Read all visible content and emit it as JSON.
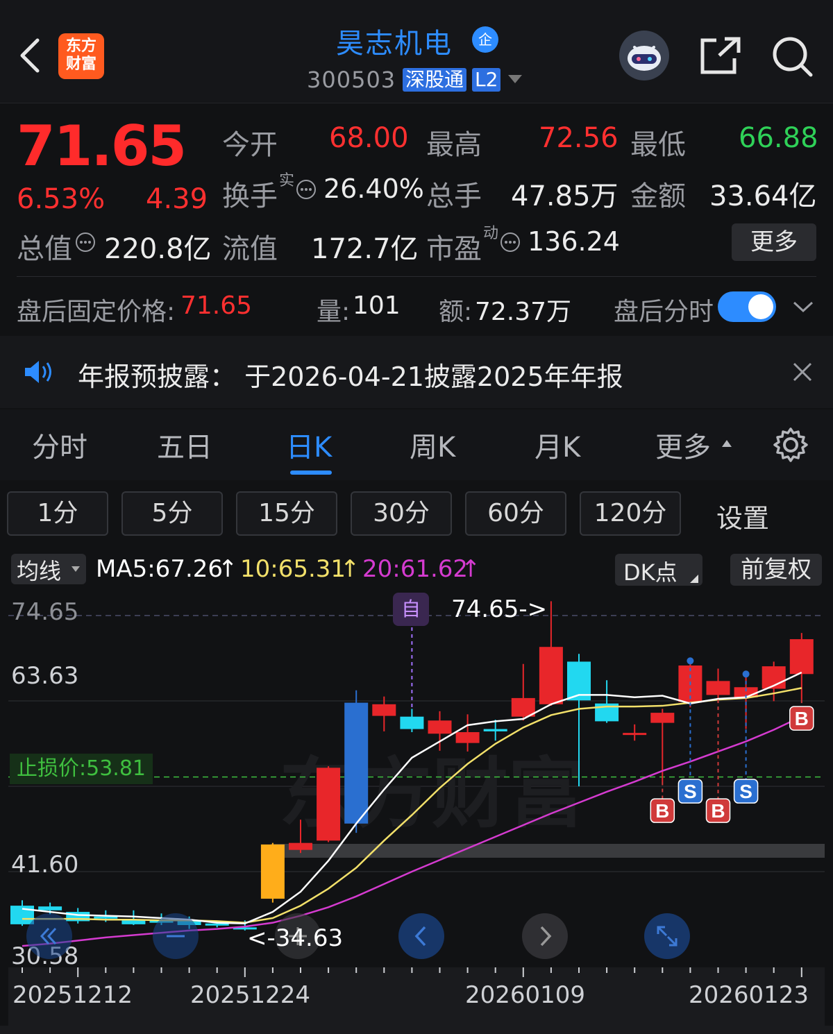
{
  "header": {
    "stock_name": "昊志机电",
    "enterprise_badge": "企",
    "stock_code": "300503",
    "tag_connect": "深股通",
    "tag_level": "L2",
    "logo_text_line1": "东方",
    "logo_text_line2": "财富"
  },
  "quote": {
    "price": "71.65",
    "change_pct": "6.53%",
    "change_abs": "4.39",
    "open_label": "今开",
    "open_value": "68.00",
    "high_label": "最高",
    "high_value": "72.56",
    "low_label": "最低",
    "low_value": "66.88",
    "turnover_label": "换手",
    "turnover_sup": "实",
    "turnover_value": "26.40%",
    "volume_label": "总手",
    "volume_value": "47.85万",
    "amount_label": "金额",
    "amount_value": "33.64亿",
    "mktcap_label": "总值",
    "mktcap_value": "220.8亿",
    "float_label": "流值",
    "float_value": "172.7亿",
    "pe_label": "市盈",
    "pe_sup": "动",
    "pe_value": "136.24",
    "more_label": "更多"
  },
  "after_hours": {
    "fixed_price_label": "盘后固定价格:",
    "fixed_price_value": "71.65",
    "vol_label": "量:",
    "vol_value": "101",
    "amt_label": "额:",
    "amt_value": "72.37万",
    "toggle_label": "盘后分时",
    "toggle_on": true
  },
  "notice": {
    "text": "年报预披露：  于2026-04-21披露2025年年报"
  },
  "tabs": [
    "分时",
    "五日",
    "日K",
    "周K",
    "月K",
    "更多"
  ],
  "active_tab": "日K",
  "periods": [
    "1分",
    "5分",
    "15分",
    "30分",
    "60分",
    "120分"
  ],
  "periods_settings": "设置",
  "indicator_bar": {
    "ma_selector": "均线",
    "ma5": "MA5:67.26",
    "ma10": "10:65.31",
    "ma20": "20:61.62",
    "dk_label": "DK点",
    "adjust_label": "前复权"
  },
  "colors": {
    "up": "#e8262a",
    "down": "#22d8f0",
    "ma5": "#ffffff",
    "ma10": "#f2e06a",
    "ma20": "#d53bd0",
    "accent": "#2d8cff",
    "stop": "#3fbf3f"
  },
  "chart_data": {
    "type": "candlestick",
    "y_ticks": [
      "74.65",
      "63.63",
      "41.60",
      "30.58"
    ],
    "x_ticks": [
      "20251212",
      "20251224",
      "20260109",
      "20260123"
    ],
    "ylim": [
      30.58,
      74.65
    ],
    "max_label": "74.65->",
    "min_label": "<-34.63",
    "stop_label": "止损价:53.81",
    "stop_value": 53.81,
    "zi_badge": "自",
    "grid": true,
    "candles": [
      {
        "o": 37.2,
        "h": 37.9,
        "l": 34.6,
        "c": 34.8
      },
      {
        "o": 37.1,
        "h": 37.6,
        "l": 36.1,
        "c": 36.6
      },
      {
        "o": 36.4,
        "h": 36.9,
        "l": 34.9,
        "c": 35.2
      },
      {
        "o": 35.8,
        "h": 36.6,
        "l": 35.1,
        "c": 35.6
      },
      {
        "o": 35.4,
        "h": 36.6,
        "l": 34.7,
        "c": 34.8
      },
      {
        "o": 35.4,
        "h": 36.2,
        "l": 34.7,
        "c": 35.0
      },
      {
        "o": 35.3,
        "h": 35.8,
        "l": 34.2,
        "c": 34.7
      },
      {
        "o": 34.9,
        "h": 35.2,
        "l": 34.4,
        "c": 34.7
      },
      {
        "o": 34.4,
        "h": 35.3,
        "l": 34.0,
        "c": 34.2
      },
      {
        "o": 38.1,
        "h": 45.3,
        "l": 37.6,
        "c": 45.1
      },
      {
        "o": 44.4,
        "h": 48.3,
        "l": 44.0,
        "c": 45.3
      },
      {
        "o": 45.6,
        "h": 55.2,
        "l": 45.4,
        "c": 55.0
      },
      {
        "o": 63.4,
        "h": 65.0,
        "l": 46.6,
        "c": 47.8
      },
      {
        "o": 61.7,
        "h": 64.2,
        "l": 59.7,
        "c": 63.2
      },
      {
        "o": 61.6,
        "h": 62.6,
        "l": 59.6,
        "c": 60.0
      },
      {
        "o": 59.4,
        "h": 62.3,
        "l": 57.2,
        "c": 61.1
      },
      {
        "o": 58.2,
        "h": 61.9,
        "l": 57.1,
        "c": 59.6
      },
      {
        "o": 60.0,
        "h": 61.2,
        "l": 58.5,
        "c": 59.7
      },
      {
        "o": 61.6,
        "h": 68.4,
        "l": 61.1,
        "c": 64.0
      },
      {
        "o": 63.2,
        "h": 76.5,
        "l": 63.0,
        "c": 70.6
      },
      {
        "o": 68.7,
        "h": 69.7,
        "l": 52.6,
        "c": 63.7
      },
      {
        "o": 63.3,
        "h": 66.3,
        "l": 60.8,
        "c": 61.0
      },
      {
        "o": 59.5,
        "h": 60.6,
        "l": 58.5,
        "c": 59.5
      },
      {
        "o": 60.8,
        "h": 62.6,
        "l": 53.2,
        "c": 62.1
      },
      {
        "o": 63.5,
        "h": 68.8,
        "l": 62.8,
        "c": 68.2
      },
      {
        "o": 64.4,
        "h": 67.8,
        "l": 63.8,
        "c": 66.2
      },
      {
        "o": 64.1,
        "h": 67.1,
        "l": 60.0,
        "c": 65.4
      },
      {
        "o": 65.2,
        "h": 68.7,
        "l": 63.6,
        "c": 68.1
      },
      {
        "o": 67.1,
        "h": 72.4,
        "l": 63.8,
        "c": 71.6
      }
    ],
    "ma5": [
      36.8,
      36.4,
      36.0,
      35.9,
      35.8,
      35.6,
      35.4,
      35.0,
      34.9,
      36.4,
      39.0,
      43.0,
      47.8,
      52.2,
      56.3,
      58.4,
      60.5,
      61.0,
      61.3,
      63.2,
      64.4,
      64.4,
      64.1,
      64.3,
      63.3,
      63.9,
      64.1,
      65.6,
      67.3
    ],
    "ma10": [
      35.5,
      35.5,
      35.5,
      35.4,
      35.4,
      35.3,
      35.3,
      35.2,
      35.0,
      35.6,
      37.2,
      39.4,
      42.1,
      45.6,
      48.9,
      52.4,
      55.5,
      58.1,
      60.2,
      61.8,
      62.6,
      62.9,
      62.9,
      63.0,
      63.4,
      63.8,
      64.0,
      64.6,
      65.3
    ],
    "ma20": [
      32.0,
      32.3,
      32.7,
      33.1,
      33.4,
      33.7,
      34.0,
      34.2,
      34.5,
      35.0,
      35.9,
      37.0,
      38.4,
      40.0,
      41.6,
      43.1,
      44.6,
      46.1,
      47.6,
      49.1,
      50.5,
      51.9,
      53.2,
      54.6,
      55.8,
      57.1,
      58.4,
      59.9,
      61.6
    ],
    "signals": [
      {
        "i": 23,
        "type": "B"
      },
      {
        "i": 24,
        "type": "S"
      },
      {
        "i": 25,
        "type": "B"
      },
      {
        "i": 26,
        "type": "S"
      },
      {
        "i": 28,
        "type": "B"
      }
    ]
  }
}
